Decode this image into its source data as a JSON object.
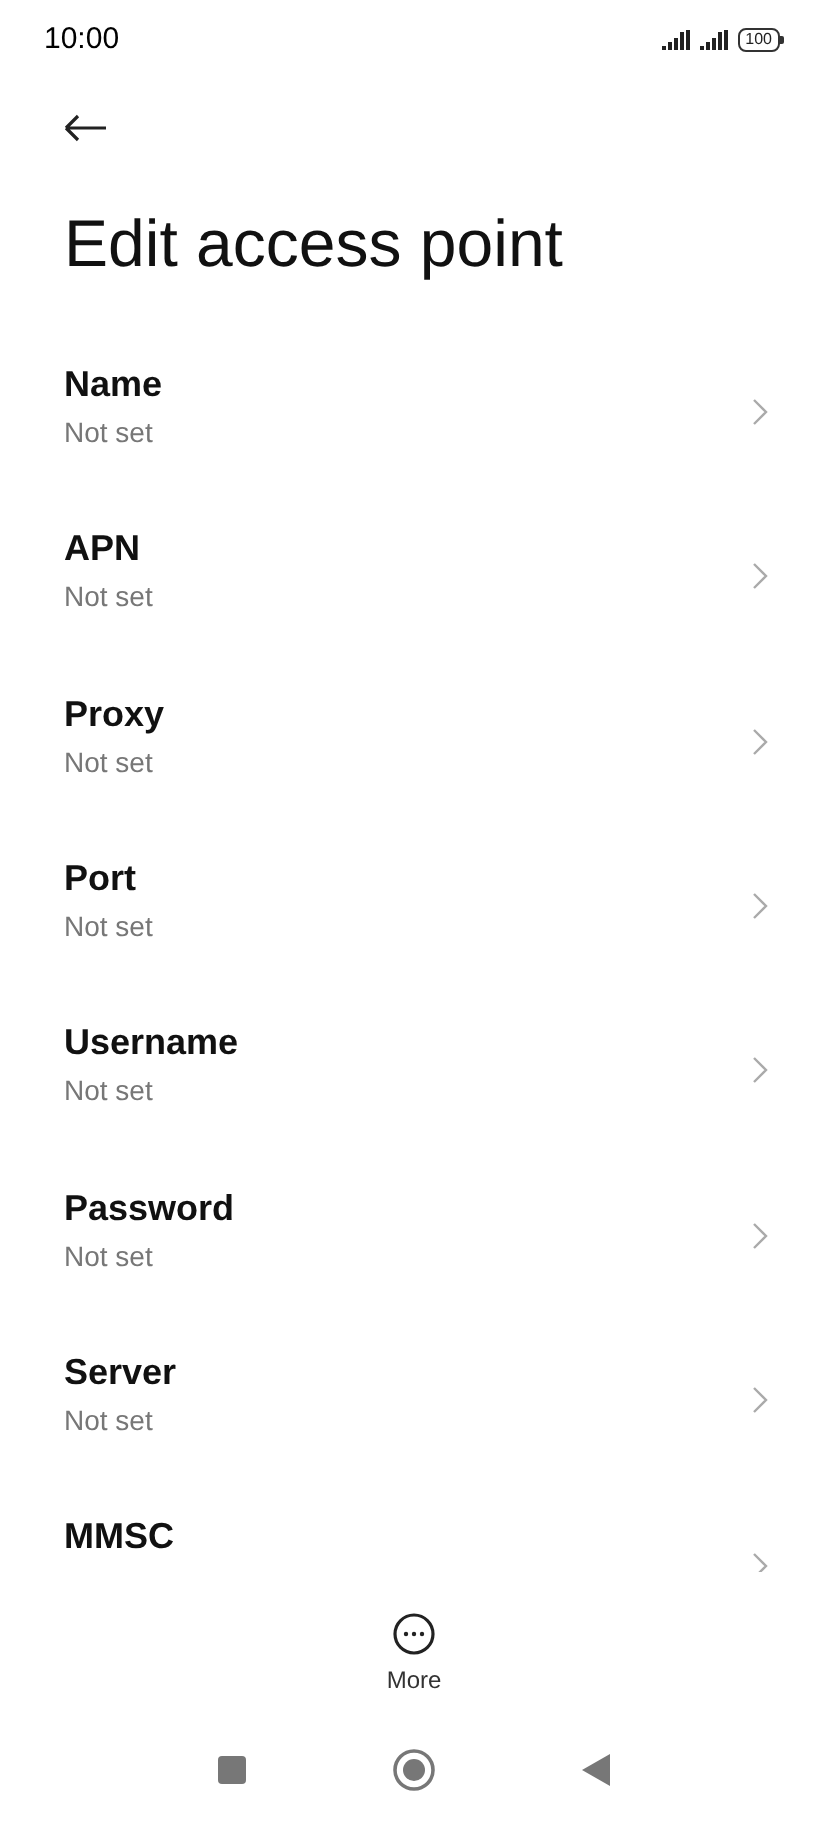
{
  "status_bar": {
    "time": "10:00",
    "battery": "100"
  },
  "title": "Edit access point",
  "items": [
    {
      "label": "Name",
      "value": "Not set"
    },
    {
      "label": "APN",
      "value": "Not set"
    },
    {
      "label": "Proxy",
      "value": "Not set"
    },
    {
      "label": "Port",
      "value": "Not set"
    },
    {
      "label": "Username",
      "value": "Not set"
    },
    {
      "label": "Password",
      "value": "Not set"
    },
    {
      "label": "Server",
      "value": "Not set"
    },
    {
      "label": "MMSC"
    }
  ],
  "more": {
    "label": "More"
  }
}
